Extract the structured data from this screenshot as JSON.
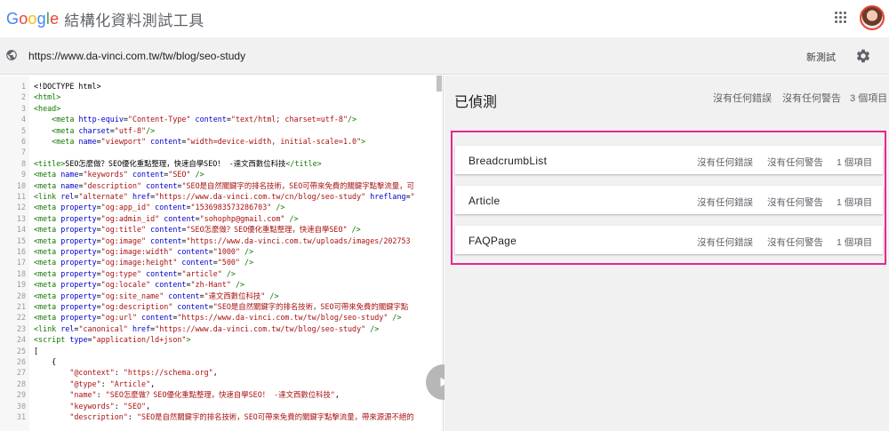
{
  "header": {
    "logo_letters": [
      {
        "ch": "G",
        "color": "#4285F4"
      },
      {
        "ch": "o",
        "color": "#EA4335"
      },
      {
        "ch": "o",
        "color": "#FBBC05"
      },
      {
        "ch": "g",
        "color": "#4285F4"
      },
      {
        "ch": "l",
        "color": "#34A853"
      },
      {
        "ch": "e",
        "color": "#EA4335"
      }
    ],
    "app_title": "結構化資料測試工具",
    "apps_icon": "apps-grid-icon",
    "avatar_icon": "user-avatar"
  },
  "urlbar": {
    "globe_icon": "globe-icon",
    "url": "https://www.da-vinci.com.tw/tw/blog/seo-study",
    "new_test_label": "新測試",
    "settings_icon": "gear-icon"
  },
  "code": {
    "lines": [
      {
        "n": "1",
        "html": "<span class=\"plain\">&lt;!DOCTYPE html&gt;</span>"
      },
      {
        "n": "2",
        "html": "<span class=\"tag\">&lt;html&gt;</span>"
      },
      {
        "n": "3",
        "html": "<span class=\"tag\">&lt;head&gt;</span>"
      },
      {
        "n": "4",
        "html": "    <span class=\"tag\">&lt;meta</span> <span class=\"attr\">http-equiv</span>=<span class=\"val\">\"Content-Type\"</span> <span class=\"attr\">content</span>=<span class=\"val\">\"text/html; charset=utf-8\"</span><span class=\"tag\">/&gt;</span>"
      },
      {
        "n": "5",
        "html": "    <span class=\"tag\">&lt;meta</span> <span class=\"attr\">charset</span>=<span class=\"val\">\"utf-8\"</span><span class=\"tag\">/&gt;</span>"
      },
      {
        "n": "6",
        "html": "    <span class=\"tag\">&lt;meta</span> <span class=\"attr\">name</span>=<span class=\"val\">\"viewport\"</span> <span class=\"attr\">content</span>=<span class=\"val\">\"width=device-width, initial-scale=1.0\"</span><span class=\"tag\">&gt;</span>"
      },
      {
        "n": "7",
        "html": ""
      },
      {
        "n": "8",
        "html": "<span class=\"tag\">&lt;title&gt;</span>SEO怎麼做？SEO優化重點整理，快速自學SEO！ -達文西數位科技<span class=\"tag\">&lt;/title&gt;</span>"
      },
      {
        "n": "9",
        "html": "<span class=\"tag\">&lt;meta</span> <span class=\"attr\">name</span>=<span class=\"val\">\"keywords\"</span> <span class=\"attr\">content</span>=<span class=\"val\">\"SEO\"</span> <span class=\"tag\">/&gt;</span>"
      },
      {
        "n": "10",
        "html": "<span class=\"tag\">&lt;meta</span> <span class=\"attr\">name</span>=<span class=\"val\">\"description\"</span> <span class=\"attr\">content</span>=<span class=\"val\">\"SEO是自然關鍵字的排名技術，SEO可帶來免費的關鍵字點擊流量，可</span>"
      },
      {
        "n": "11",
        "html": "<span class=\"tag\">&lt;link</span> <span class=\"attr\">rel</span>=<span class=\"val\">\"alternate\"</span> <span class=\"attr\">href</span>=<span class=\"val\">\"https://www.da-vinci.com.tw/cn/blog/seo-study\"</span> <span class=\"attr\">hreflang</span>=<span class=\"val\">\"</span>"
      },
      {
        "n": "12",
        "html": "<span class=\"tag\">&lt;meta</span> <span class=\"attr\">property</span>=<span class=\"val\">\"og:app_id\"</span> <span class=\"attr\">content</span>=<span class=\"val\">\"1536983573286703\"</span> <span class=\"tag\">/&gt;</span>"
      },
      {
        "n": "13",
        "html": "<span class=\"tag\">&lt;meta</span> <span class=\"attr\">property</span>=<span class=\"val\">\"og:admin_id\"</span> <span class=\"attr\">content</span>=<span class=\"val\">\"sohophp@gmail.com\"</span> <span class=\"tag\">/&gt;</span>"
      },
      {
        "n": "14",
        "html": "<span class=\"tag\">&lt;meta</span> <span class=\"attr\">property</span>=<span class=\"val\">\"og:title\"</span> <span class=\"attr\">content</span>=<span class=\"val\">\"SEO怎麼做？SEO優化重點整理，快速自學SEO\"</span> <span class=\"tag\">/&gt;</span>"
      },
      {
        "n": "15",
        "html": "<span class=\"tag\">&lt;meta</span> <span class=\"attr\">property</span>=<span class=\"val\">\"og:image\"</span> <span class=\"attr\">content</span>=<span class=\"val\">\"https://www.da-vinci.com.tw/uploads/images/202753</span>"
      },
      {
        "n": "16",
        "html": "<span class=\"tag\">&lt;meta</span> <span class=\"attr\">property</span>=<span class=\"val\">\"og:image:width\"</span> <span class=\"attr\">content</span>=<span class=\"val\">\"1000\"</span> <span class=\"tag\">/&gt;</span>"
      },
      {
        "n": "17",
        "html": "<span class=\"tag\">&lt;meta</span> <span class=\"attr\">property</span>=<span class=\"val\">\"og:image:height\"</span> <span class=\"attr\">content</span>=<span class=\"val\">\"500\"</span> <span class=\"tag\">/&gt;</span>"
      },
      {
        "n": "18",
        "html": "<span class=\"tag\">&lt;meta</span> <span class=\"attr\">property</span>=<span class=\"val\">\"og:type\"</span> <span class=\"attr\">content</span>=<span class=\"val\">\"article\"</span> <span class=\"tag\">/&gt;</span>"
      },
      {
        "n": "19",
        "html": "<span class=\"tag\">&lt;meta</span> <span class=\"attr\">property</span>=<span class=\"val\">\"og:locale\"</span> <span class=\"attr\">content</span>=<span class=\"val\">\"zh-Hant\"</span> <span class=\"tag\">/&gt;</span>"
      },
      {
        "n": "20",
        "html": "<span class=\"tag\">&lt;meta</span> <span class=\"attr\">property</span>=<span class=\"val\">\"og:site_name\"</span> <span class=\"attr\">content</span>=<span class=\"val\">\"達文西數位科技\"</span> <span class=\"tag\">/&gt;</span>"
      },
      {
        "n": "21",
        "html": "<span class=\"tag\">&lt;meta</span> <span class=\"attr\">property</span>=<span class=\"val\">\"og:description\"</span> <span class=\"attr\">content</span>=<span class=\"val\">\"SEO是自然關鍵字的排名技術，SEO可帶來免費的關鍵字點</span>"
      },
      {
        "n": "22",
        "html": "<span class=\"tag\">&lt;meta</span> <span class=\"attr\">property</span>=<span class=\"val\">\"og:url\"</span> <span class=\"attr\">content</span>=<span class=\"val\">\"https://www.da-vinci.com.tw/tw/blog/seo-study\"</span> <span class=\"tag\">/&gt;</span>"
      },
      {
        "n": "23",
        "html": "<span class=\"tag\">&lt;link</span> <span class=\"attr\">rel</span>=<span class=\"val\">\"canonical\"</span> <span class=\"attr\">href</span>=<span class=\"val\">\"https://www.da-vinci.com.tw/tw/blog/seo-study\"</span> <span class=\"tag\">/&gt;</span>"
      },
      {
        "n": "24",
        "html": "<span class=\"tag\">&lt;script</span> <span class=\"attr\">type</span>=<span class=\"val\">\"application/ld+json\"</span><span class=\"tag\">&gt;</span>"
      },
      {
        "n": "25",
        "html": "["
      },
      {
        "n": "26",
        "html": "    {"
      },
      {
        "n": "27",
        "html": "        <span class=\"val\">\"@context\"</span>: <span class=\"val\">\"https://schema.org\"</span>,"
      },
      {
        "n": "28",
        "html": "        <span class=\"val\">\"@type\"</span>: <span class=\"val\">\"Article\"</span>,"
      },
      {
        "n": "29",
        "html": "        <span class=\"val\">\"name\"</span>: <span class=\"val\">\"SEO怎麼做？SEO優化重點整理，快速自學SEO！ -達文西數位科技\"</span>,"
      },
      {
        "n": "30",
        "html": "        <span class=\"val\">\"keywords\"</span>: <span class=\"val\">\"SEO\"</span>,"
      },
      {
        "n": "31",
        "html": "        <span class=\"val\">\"description\"</span>: <span class=\"val\">\"SEO是自然關鍵字的排名技術，SEO可帶來免費的關鍵字點擊流量，帶來源源不絕的</span>"
      }
    ],
    "run_icon": "play-icon"
  },
  "results": {
    "title": "已偵測",
    "errors": "沒有任何錯誤",
    "warnings": "沒有任何警告",
    "count": "3 個項目",
    "items": [
      {
        "name": "BreadcrumbList",
        "errors": "沒有任何錯誤",
        "warnings": "沒有任何警告",
        "count": "1 個項目"
      },
      {
        "name": "Article",
        "errors": "沒有任何錯誤",
        "warnings": "沒有任何警告",
        "count": "1 個項目"
      },
      {
        "name": "FAQPage",
        "errors": "沒有任何錯誤",
        "warnings": "沒有任何警告",
        "count": "1 個項目"
      }
    ],
    "highlight_color": "#e5288e"
  }
}
